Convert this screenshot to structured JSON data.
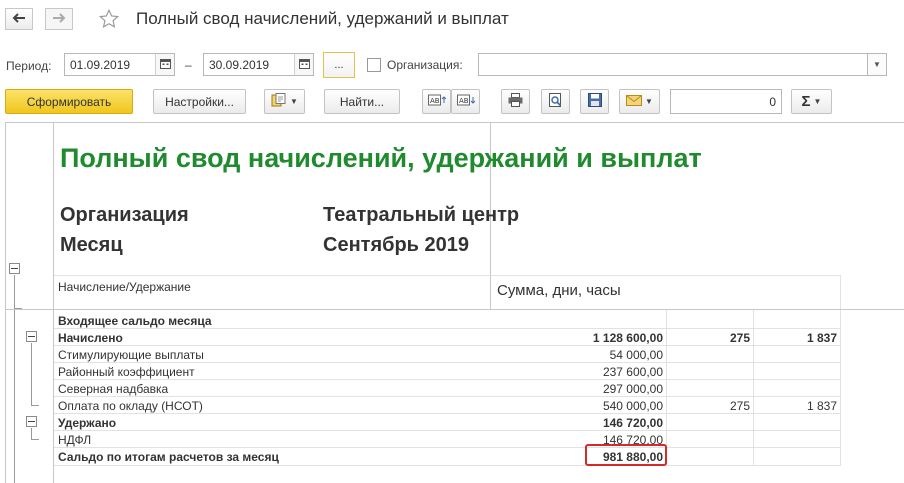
{
  "window": {
    "title": "Полный свод начислений, удержаний и выплат"
  },
  "params": {
    "period_label": "Период:",
    "date_from": "01.09.2019",
    "dash": "–",
    "date_to": "30.09.2019",
    "dots_label": "...",
    "org_label": "Организация:",
    "org_value": ""
  },
  "toolbar": {
    "generate_label": "Сформировать",
    "settings_label": "Настройки...",
    "find_label": "Найти...",
    "counter_value": "0",
    "sum_symbol": "Σ"
  },
  "report": {
    "title": "Полный свод начислений, удержаний и выплат",
    "org_key": "Организация",
    "org_value": "Театральный центр",
    "month_key": "Месяц",
    "month_value": "Сентябрь 2019",
    "col_header_left": "Начисление/Удержание",
    "col_header_right": "Сумма, дни, часы",
    "rows": [
      {
        "label": "Входящее сальдо месяца",
        "sum": "",
        "days": "",
        "hours": ""
      },
      {
        "label": "Начислено",
        "sum": "1 128 600,00",
        "days": "275",
        "hours": "1 837"
      },
      {
        "label": "Стимулирующие выплаты",
        "sum": "54 000,00",
        "days": "",
        "hours": ""
      },
      {
        "label": "Районный коэффициент",
        "sum": "237 600,00",
        "days": "",
        "hours": ""
      },
      {
        "label": "Северная надбавка",
        "sum": "297 000,00",
        "days": "",
        "hours": ""
      },
      {
        "label": "Оплата по окладу (НСОТ)",
        "sum": "540 000,00",
        "days": "275",
        "hours": "1 837"
      },
      {
        "label": "Удержано",
        "sum": "146 720,00",
        "days": "",
        "hours": ""
      },
      {
        "label": "НДФЛ",
        "sum": "146 720,00",
        "days": "",
        "hours": ""
      },
      {
        "label": "Сальдо по итогам расчетов за месяц",
        "sum": "981 880,00",
        "days": "",
        "hours": ""
      }
    ]
  },
  "colors": {
    "accent_green": "#1f8a2e",
    "primary_button": "#f3cd2d",
    "highlight_red": "#d42a2a"
  }
}
